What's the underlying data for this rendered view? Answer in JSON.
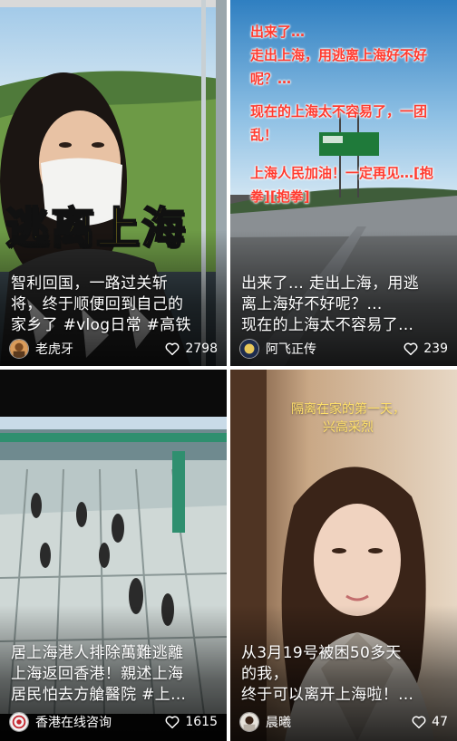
{
  "feed": {
    "cards": [
      {
        "overlay_text": "逃离上海",
        "caption": [
          "智利回国，一路过关斩",
          "将，终于顺便回到自己的",
          "家乡了 #vlog日常 #高铁"
        ],
        "author": "老虎牙",
        "likes": "2798"
      },
      {
        "overlay_lines": [
          "出来了…",
          "走出上海，用逃离上海好不好",
          "呢？…",
          "现在的上海太不容易了，一团",
          "乱！",
          "上海人民加油！一定再见…[抱",
          "拳][抱拳]"
        ],
        "caption": [
          "出来了… 走出上海，用逃",
          "离上海好不好呢？…",
          "现在的上海太不容易了…"
        ],
        "author": "阿飞正传",
        "likes": "239"
      },
      {
        "caption": [
          "居上海港人排除萬難逃離",
          "上海返回香港！親述上海",
          "居民怕去方艙醫院 #上…"
        ],
        "author": "香港在线咨询",
        "likes": "1615"
      },
      {
        "overlay_lines": [
          "隔离在家的第一天，",
          "兴高采烈"
        ],
        "caption": [
          "从3月19号被困50多天",
          "的我，",
          "终于可以离开上海啦！…"
        ],
        "author": "晨曦",
        "likes": "47"
      }
    ]
  },
  "icons": {
    "like": "heart-outline-icon"
  }
}
